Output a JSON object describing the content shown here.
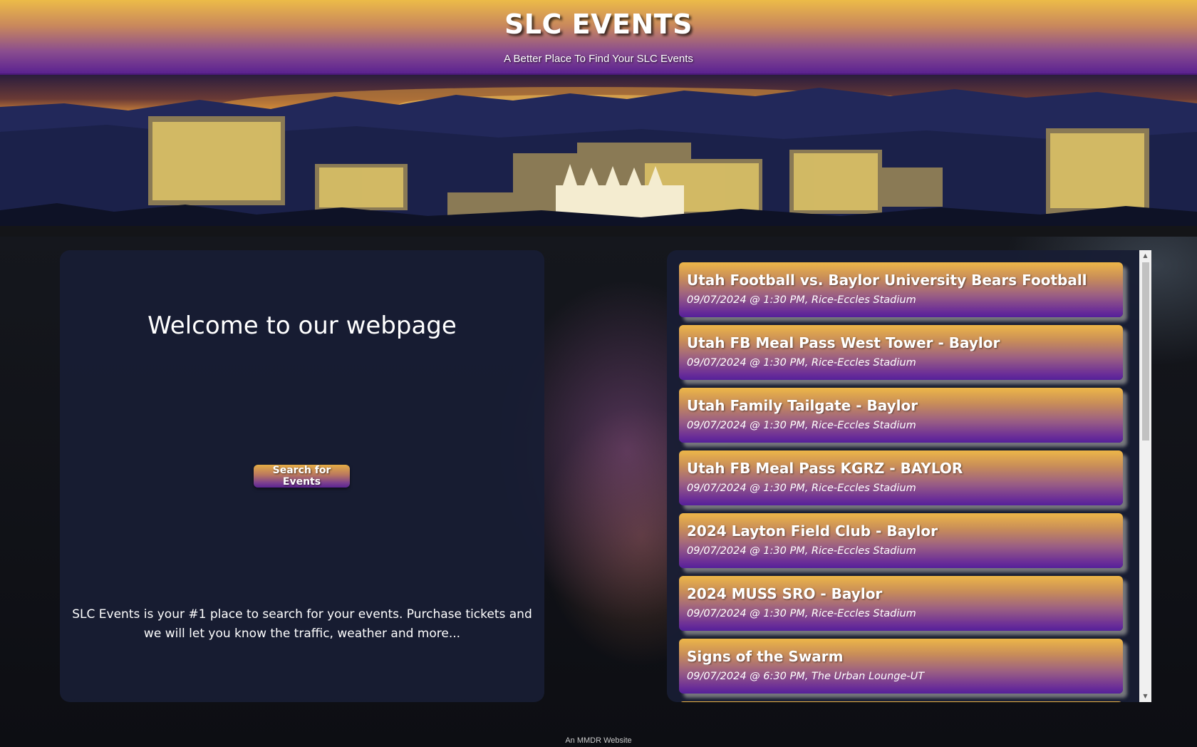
{
  "header": {
    "title": "SLC EVENTS",
    "tagline": "A Better Place To Find Your SLC Events"
  },
  "welcome": {
    "heading": "Welcome to our webpage",
    "search_button_label": "Search for Events",
    "description": "SLC Events is your #1 place to search for your events. Purchase tickets and we will let you know the traffic, weather and more..."
  },
  "events": [
    {
      "title": "Utah Football vs. Baylor University Bears Football",
      "meta": "09/07/2024 @ 1:30 PM, Rice-Eccles Stadium"
    },
    {
      "title": "Utah FB Meal Pass West Tower - Baylor",
      "meta": "09/07/2024 @ 1:30 PM, Rice-Eccles Stadium"
    },
    {
      "title": "Utah Family Tailgate - Baylor",
      "meta": "09/07/2024 @ 1:30 PM, Rice-Eccles Stadium"
    },
    {
      "title": "Utah FB Meal Pass KGRZ - BAYLOR",
      "meta": "09/07/2024 @ 1:30 PM, Rice-Eccles Stadium"
    },
    {
      "title": "2024 Layton Field Club - Baylor",
      "meta": "09/07/2024 @ 1:30 PM, Rice-Eccles Stadium"
    },
    {
      "title": "2024 MUSS SRO - Baylor",
      "meta": "09/07/2024 @ 1:30 PM, Rice-Eccles Stadium"
    },
    {
      "title": "Signs of the Swarm",
      "meta": "09/07/2024 @ 6:30 PM, The Urban Lounge-UT"
    },
    {
      "title": "",
      "meta": ""
    }
  ],
  "footer": {
    "text": "An MMDR Website"
  },
  "colors": {
    "gold": "#edb648",
    "purple": "#55209a",
    "panel": "#181d34"
  }
}
